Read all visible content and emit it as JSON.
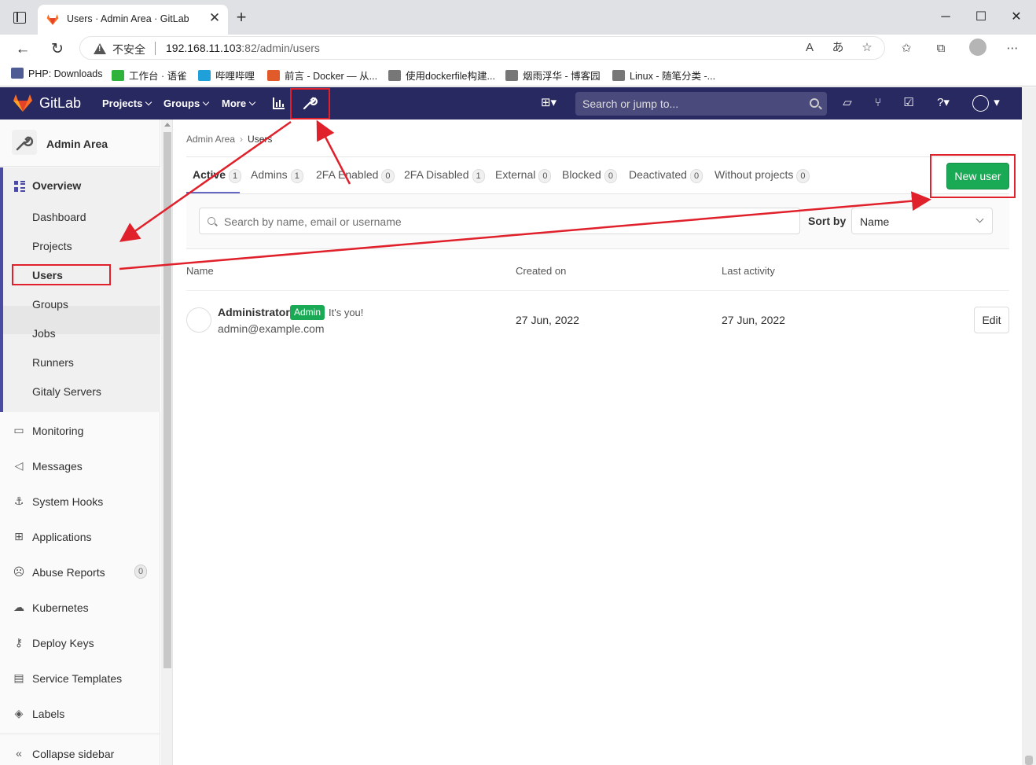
{
  "browser": {
    "tab_title": "Users · Admin Area · GitLab",
    "new_tab": "+",
    "insecure_label": "不安全",
    "url_host": "192.168.11.103",
    "url_path": ":82/admin/users",
    "bookmarks": [
      {
        "label": "PHP: Downloads",
        "color": "#4f5b93"
      },
      {
        "label": "工作台 · 语雀",
        "color": "#2fb33a"
      },
      {
        "label": "哔哩哔哩",
        "color": "#20a0d8"
      },
      {
        "label": "前言 - Docker — 从...",
        "color": "#e05a2a"
      },
      {
        "label": "使用dockerfile构建...",
        "color": "#555555"
      },
      {
        "label": "烟雨浮华 - 博客园",
        "color": "#555555"
      },
      {
        "label": "Linux - 随笔分类 -...",
        "color": "#555555"
      }
    ]
  },
  "header": {
    "brand": "GitLab",
    "menus": [
      "Projects",
      "Groups",
      "More"
    ],
    "search_placeholder": "Search or jump to...",
    "colors": {
      "bg": "#292961",
      "search": "#4a4a7c"
    }
  },
  "sidebar": {
    "title": "Admin Area",
    "overview": "Overview",
    "overview_items": [
      "Dashboard",
      "Projects",
      "Users",
      "Groups",
      "Jobs",
      "Runners",
      "Gitaly Servers"
    ],
    "active_item": "Users",
    "items": [
      {
        "label": "Monitoring",
        "icon": "monitor-icon"
      },
      {
        "label": "Messages",
        "icon": "bullhorn-icon"
      },
      {
        "label": "System Hooks",
        "icon": "anchor-icon"
      },
      {
        "label": "Applications",
        "icon": "grid-icon"
      },
      {
        "label": "Abuse Reports",
        "icon": "smiley-icon",
        "badge": "0"
      },
      {
        "label": "Kubernetes",
        "icon": "cloud-icon"
      },
      {
        "label": "Deploy Keys",
        "icon": "key-icon"
      },
      {
        "label": "Service Templates",
        "icon": "template-icon"
      },
      {
        "label": "Labels",
        "icon": "label-icon"
      }
    ],
    "collapse": "Collapse sidebar"
  },
  "breadcrumb": [
    "Admin Area",
    "Users"
  ],
  "tabs": [
    {
      "label": "Active",
      "count": "1"
    },
    {
      "label": "Admins",
      "count": "1"
    },
    {
      "label": "2FA Enabled",
      "count": "0"
    },
    {
      "label": "2FA Disabled",
      "count": "1"
    },
    {
      "label": "External",
      "count": "0"
    },
    {
      "label": "Blocked",
      "count": "0"
    },
    {
      "label": "Deactivated",
      "count": "0"
    },
    {
      "label": "Without projects",
      "count": "0"
    }
  ],
  "new_user_button": "New user",
  "filter": {
    "search_placeholder": "Search by name, email or username",
    "sort_label": "Sort by",
    "sort_value": "Name"
  },
  "table": {
    "headers": [
      "Name",
      "Created on",
      "Last activity"
    ],
    "rows": [
      {
        "name": "Administrator",
        "badge": "Admin",
        "note": "It's you!",
        "email": "admin@example.com",
        "created": "27 Jun, 2022",
        "last_activity": "27 Jun, 2022",
        "action": "Edit"
      }
    ]
  }
}
